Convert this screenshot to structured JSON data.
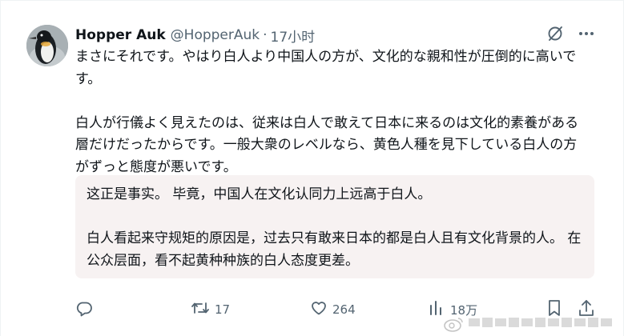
{
  "tweet": {
    "author_name": "Hopper Auk",
    "author_handle": "@HopperAuk",
    "separator": "·",
    "timestamp": "17小时",
    "paragraphs": [
      "まさにそれです。やはり白人より中国人の方が、文化的な親和性が圧倒的に高いです。",
      "白人が行儀よく見えたのは、従来は白人で敢えて日本に来るのは文化的素養がある層だけだったからです。一般大衆のレベルなら、黄色人種を見下している白人の方がずっと態度が悪いです。"
    ],
    "translation": [
      "这正是事实。 毕竟，中国人在文化认同力上远高于白人。",
      "白人看起来守规矩的原因是，过去只有敢来日本的都是白人且有文化背景的人。 在公众层面，看不起黄种种族的白人态度更差。"
    ],
    "actions": {
      "reply_count": "",
      "retweet_count": "17",
      "like_count": "264",
      "view_count": "18万"
    },
    "icons": {
      "grok": "grok-slash-icon",
      "more": "more-horizontal-icon",
      "reply": "reply-bubble-icon",
      "retweet": "retweet-icon",
      "like": "heart-icon",
      "views": "bar-chart-icon",
      "bookmark": "bookmark-icon",
      "share": "share-upload-icon"
    },
    "colors": {
      "text": "#0f1419",
      "muted": "#536471",
      "translation_bg": "#f7f2f2"
    }
  }
}
